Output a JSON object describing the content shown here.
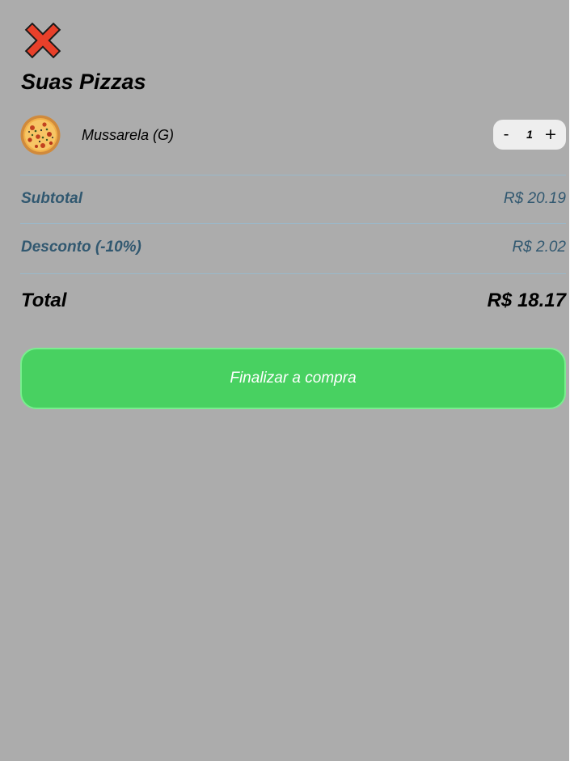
{
  "close_icon": "close-x-icon",
  "cart": {
    "title": "Suas Pizzas",
    "items": [
      {
        "image_icon": "pizza-icon",
        "name": "Mussarela (G)",
        "quantity": "1",
        "decrement_label": "-",
        "increment_label": "+"
      }
    ]
  },
  "summary": {
    "subtotal_label": "Subtotal",
    "subtotal_value": "R$ 20.19",
    "discount_label": "Desconto (-10%)",
    "discount_value": "R$ 2.02",
    "total_label": "Total",
    "total_value": "R$ 18.17"
  },
  "checkout": {
    "label": "Finalizar a compra"
  },
  "colors": {
    "background": "#acacac",
    "accent_green": "#48d161",
    "summary_text": "#315870",
    "divider": "#99b9cb",
    "close_red": "#e8402a"
  }
}
